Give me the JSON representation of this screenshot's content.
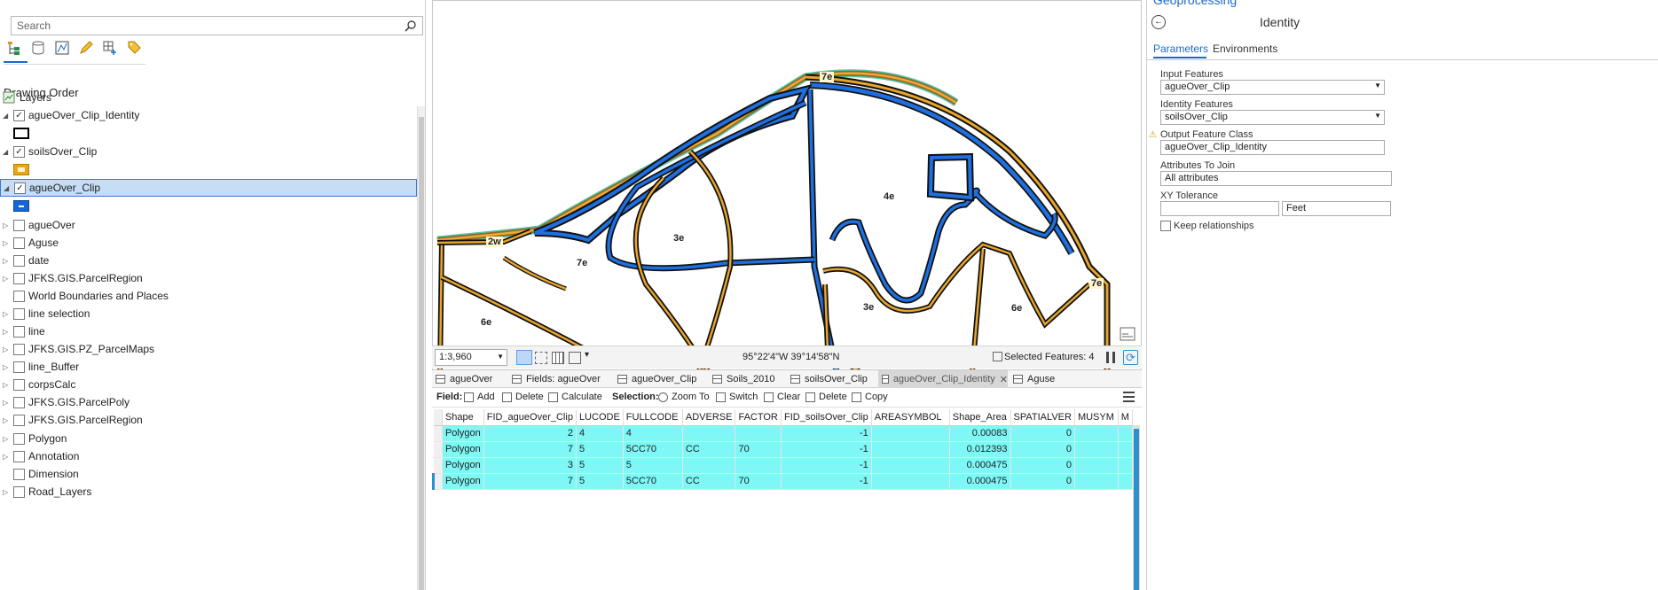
{
  "contents": {
    "search_placeholder": "Search",
    "drawing_order_title": "Drawing Order",
    "layers_label": "Layers",
    "layers": [
      {
        "name": "agueOver_Clip_Identity",
        "checked": true,
        "expanded": true
      },
      {
        "name": "soilsOver_Clip",
        "checked": true,
        "expanded": true
      },
      {
        "name": "agueOver_Clip",
        "checked": true,
        "expanded": true,
        "selected": true
      },
      {
        "name": "agueOver",
        "checked": false
      },
      {
        "name": "Aguse",
        "checked": false
      },
      {
        "name": "date",
        "checked": false
      },
      {
        "name": "JFKS.GIS.ParcelRegion",
        "checked": false
      },
      {
        "name": "World Boundaries and Places",
        "checked": false
      },
      {
        "name": "line selection",
        "checked": false
      },
      {
        "name": "line",
        "checked": false
      },
      {
        "name": "JFKS.GIS.PZ_ParcelMaps",
        "checked": false
      },
      {
        "name": "line_Buffer",
        "checked": false
      },
      {
        "name": "corpsCalc",
        "checked": false
      },
      {
        "name": "JFKS.GIS.ParcelPoly",
        "checked": false
      },
      {
        "name": "JFKS.GIS.ParcelRegion",
        "checked": false
      },
      {
        "name": "Polygon",
        "checked": false
      },
      {
        "name": "Annotation",
        "checked": false
      },
      {
        "name": "Dimension",
        "checked": false
      },
      {
        "name": "Road_Layers",
        "checked": false
      }
    ],
    "symbol_colors": {
      "identity": "#000000",
      "soils": "#e6a817",
      "ague": "#1565d8"
    }
  },
  "map": {
    "labels": [
      "7e",
      "2w",
      "7e",
      "3e",
      "4e",
      "6e",
      "3e",
      "6e",
      "7e"
    ],
    "scale": "1:3,960",
    "coordinates": "95°22'4\"W 39°14'58\"N",
    "selected_features": "Selected Features: 4"
  },
  "tabs": [
    "agueOver",
    "Fields:  agueOver",
    "agueOver_Clip",
    "Soils_2010",
    "soilsOver_Clip",
    "agueOver_Clip_Identity",
    "Aguse"
  ],
  "table_toolbar": {
    "field_label": "Field:",
    "add": "Add",
    "delete": "Delete",
    "calculate": "Calculate",
    "selection_label": "Selection:",
    "zoom_to": "Zoom To",
    "switch": "Switch",
    "clear": "Clear",
    "sel_delete": "Delete",
    "copy": "Copy"
  },
  "table": {
    "columns": [
      "Shape",
      "FID_agueOver_Clip",
      "LUCODE",
      "FULLCODE",
      "ADVERSE",
      "FACTOR",
      "FID_soilsOver_Clip",
      "AREASYMBOL",
      "Shape_Area",
      "SPATIALVER",
      "MUSYM",
      "M"
    ],
    "rows": [
      [
        "Polygon",
        "2",
        "4",
        "4",
        "",
        "",
        "-1",
        "",
        "0.00083",
        "0",
        "",
        ""
      ],
      [
        "Polygon",
        "7",
        "5",
        "5CC70",
        "CC",
        "70",
        "-1",
        "",
        "0.012393",
        "0",
        "",
        ""
      ],
      [
        "Polygon",
        "3",
        "5",
        "5",
        "",
        "",
        "-1",
        "",
        "0.000475",
        "0",
        "",
        ""
      ],
      [
        "Polygon",
        "7",
        "5",
        "5CC70",
        "CC",
        "70",
        "-1",
        "",
        "0.000475",
        "0",
        "",
        ""
      ]
    ]
  },
  "geoprocessing": {
    "header": "Geoprocessing",
    "tool_title": "Identity",
    "tab_parameters": "Parameters",
    "tab_environments": "Environments",
    "input_features_label": "Input Features",
    "input_features_value": "agueOver_Clip",
    "identity_features_label": "Identity Features",
    "identity_features_value": "soilsOver_Clip",
    "output_label": "Output Feature Class",
    "output_value": "agueOver_Clip_Identity",
    "attributes_label": "Attributes To Join",
    "attributes_value": "All attributes",
    "xy_label": "XY Tolerance",
    "xy_value": "",
    "xy_unit": "Feet",
    "keep_rel_label": "Keep relationships"
  }
}
